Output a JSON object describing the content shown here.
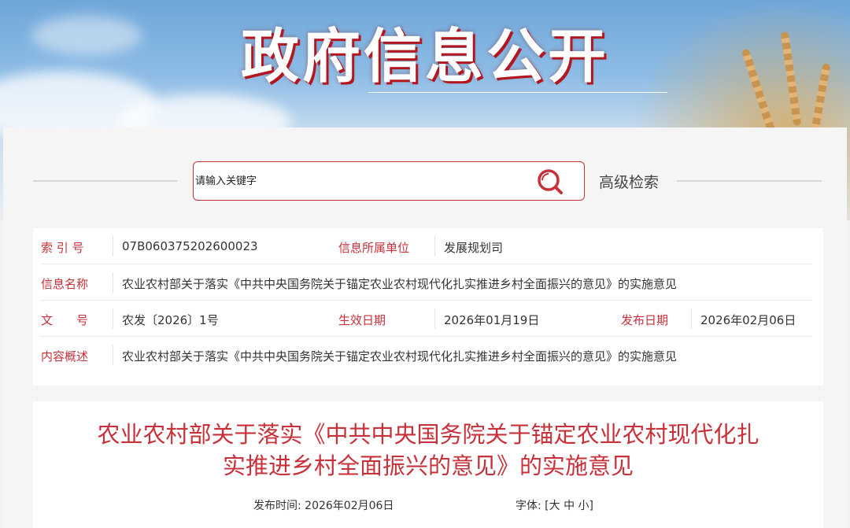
{
  "banner": {
    "title": "政府信息公开"
  },
  "search": {
    "placeholder": "请输入关键字",
    "value": "",
    "advanced_label": "高级检索"
  },
  "info": {
    "index_label": "索 引 号",
    "index_value": "07B060375202600023",
    "unit_label": "信息所属单位",
    "unit_value": "发展规划司",
    "name_label": "信息名称",
    "name_value": "农业农村部关于落实《中共中央国务院关于锚定农业农村现代化扎实推进乡村全面振兴的意见》的实施意见",
    "docno_label": "文　　号",
    "docno_value": "农发〔2026〕1号",
    "effective_label": "生效日期",
    "effective_value": "2026年01月19日",
    "publish_label": "发布日期",
    "publish_value": "2026年02月06日",
    "summary_label": "内容概述",
    "summary_value": "农业农村部关于落实《中共中央国务院关于锚定农业农村现代化扎实推进乡村全面振兴的意见》的实施意见"
  },
  "article": {
    "title_line1": "农业农村部关于落实《中共中央国务院关于锚定农业农村现代化扎",
    "title_line2": "实推进乡村全面振兴的意见》的实施意见",
    "publish_time_label": "发布时间:",
    "publish_time_value": "2026年02月06日",
    "font_label": "字体:",
    "font_open": "[",
    "font_large": "大",
    "font_medium": "中",
    "font_small": "小",
    "font_close": "]"
  },
  "colors": {
    "accent": "#c8313a",
    "text": "#333333",
    "background": "#f5f5f5"
  }
}
